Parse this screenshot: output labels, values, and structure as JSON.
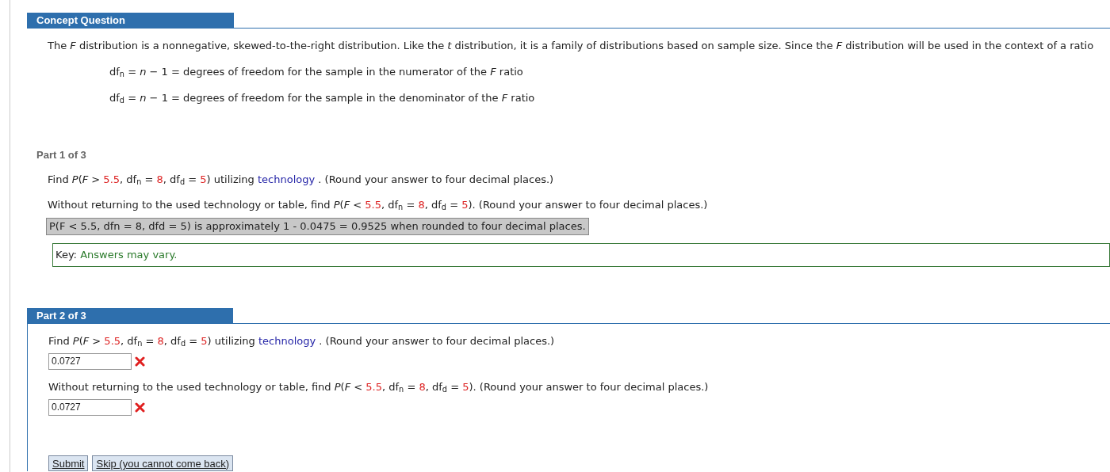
{
  "concept": {
    "title": "Concept Question",
    "intro": "The *F* distribution is a nonnegative, skewed-to-the-right distribution. Like the *t* distribution, it is a family of distributions based on sample size. Since the *F* distribution will be used in the context of a ratio",
    "formulas": [
      "df$_{n}$ = *n* − 1 = degrees of freedom for the sample in the numerator of the *F* ratio",
      "df$_{d}$ = *n* − 1 = degrees of freedom for the sample in the denominator of the *F* ratio"
    ]
  },
  "parts": [
    {
      "title": "Part 1 of 3",
      "active": false,
      "questions": [
        {
          "segments": [
            {
              "kind": "text",
              "text": "Find *P*(*F* > "
            },
            {
              "kind": "value",
              "text": "5.5"
            },
            {
              "kind": "text",
              "text": ", df$_{n}$ = "
            },
            {
              "kind": "value",
              "text": "8"
            },
            {
              "kind": "text",
              "text": ", df$_{d}$ = "
            },
            {
              "kind": "value",
              "text": "5"
            },
            {
              "kind": "text",
              "text": ") utilizing "
            },
            {
              "kind": "link",
              "text": "technology"
            },
            {
              "kind": "text",
              "text": " . (Round your answer to four decimal places.)"
            }
          ]
        },
        {
          "segments": [
            {
              "kind": "text",
              "text": "Without returning to the used technology or table, find *P*(*F* < "
            },
            {
              "kind": "value",
              "text": "5.5"
            },
            {
              "kind": "text",
              "text": ", df$_{n}$ = "
            },
            {
              "kind": "value",
              "text": "8"
            },
            {
              "kind": "text",
              "text": ", df$_{d}$ = "
            },
            {
              "kind": "value",
              "text": "5"
            },
            {
              "kind": "text",
              "text": "). (Round your answer to four decimal places.)"
            }
          ],
          "solution": "P(F < 5.5, dfn = 8, dfd = 5) is approximately 1 - 0.0475 = 0.9525 when rounded to four decimal places."
        }
      ],
      "key": {
        "label": "Key:",
        "text": "Answers may vary."
      }
    },
    {
      "title": "Part 2 of 3",
      "active": true,
      "questions": [
        {
          "segments": [
            {
              "kind": "text",
              "text": "Find *P*(*F* > "
            },
            {
              "kind": "value",
              "text": "5.5"
            },
            {
              "kind": "text",
              "text": ", df$_{n}$ = "
            },
            {
              "kind": "value",
              "text": "8"
            },
            {
              "kind": "text",
              "text": ", df$_{d}$ = "
            },
            {
              "kind": "value",
              "text": "5"
            },
            {
              "kind": "text",
              "text": ") utilizing "
            },
            {
              "kind": "link",
              "text": "technology"
            },
            {
              "kind": "text",
              "text": " . (Round your answer to four decimal places.)"
            }
          ],
          "answer": {
            "value": "0.0727",
            "correct": false
          }
        },
        {
          "segments": [
            {
              "kind": "text",
              "text": "Without returning to the used technology or table, find *P*(*F* < "
            },
            {
              "kind": "value",
              "text": "5.5"
            },
            {
              "kind": "text",
              "text": ", df$_{n}$ = "
            },
            {
              "kind": "value",
              "text": "8"
            },
            {
              "kind": "text",
              "text": ", df$_{d}$ = "
            },
            {
              "kind": "value",
              "text": "5"
            },
            {
              "kind": "text",
              "text": "). (Round your answer to four decimal places.)"
            }
          ],
          "answer": {
            "value": "0.0727",
            "correct": false
          }
        }
      ],
      "buttons": [
        "Submit",
        "Skip (you cannot come back)"
      ]
    }
  ]
}
